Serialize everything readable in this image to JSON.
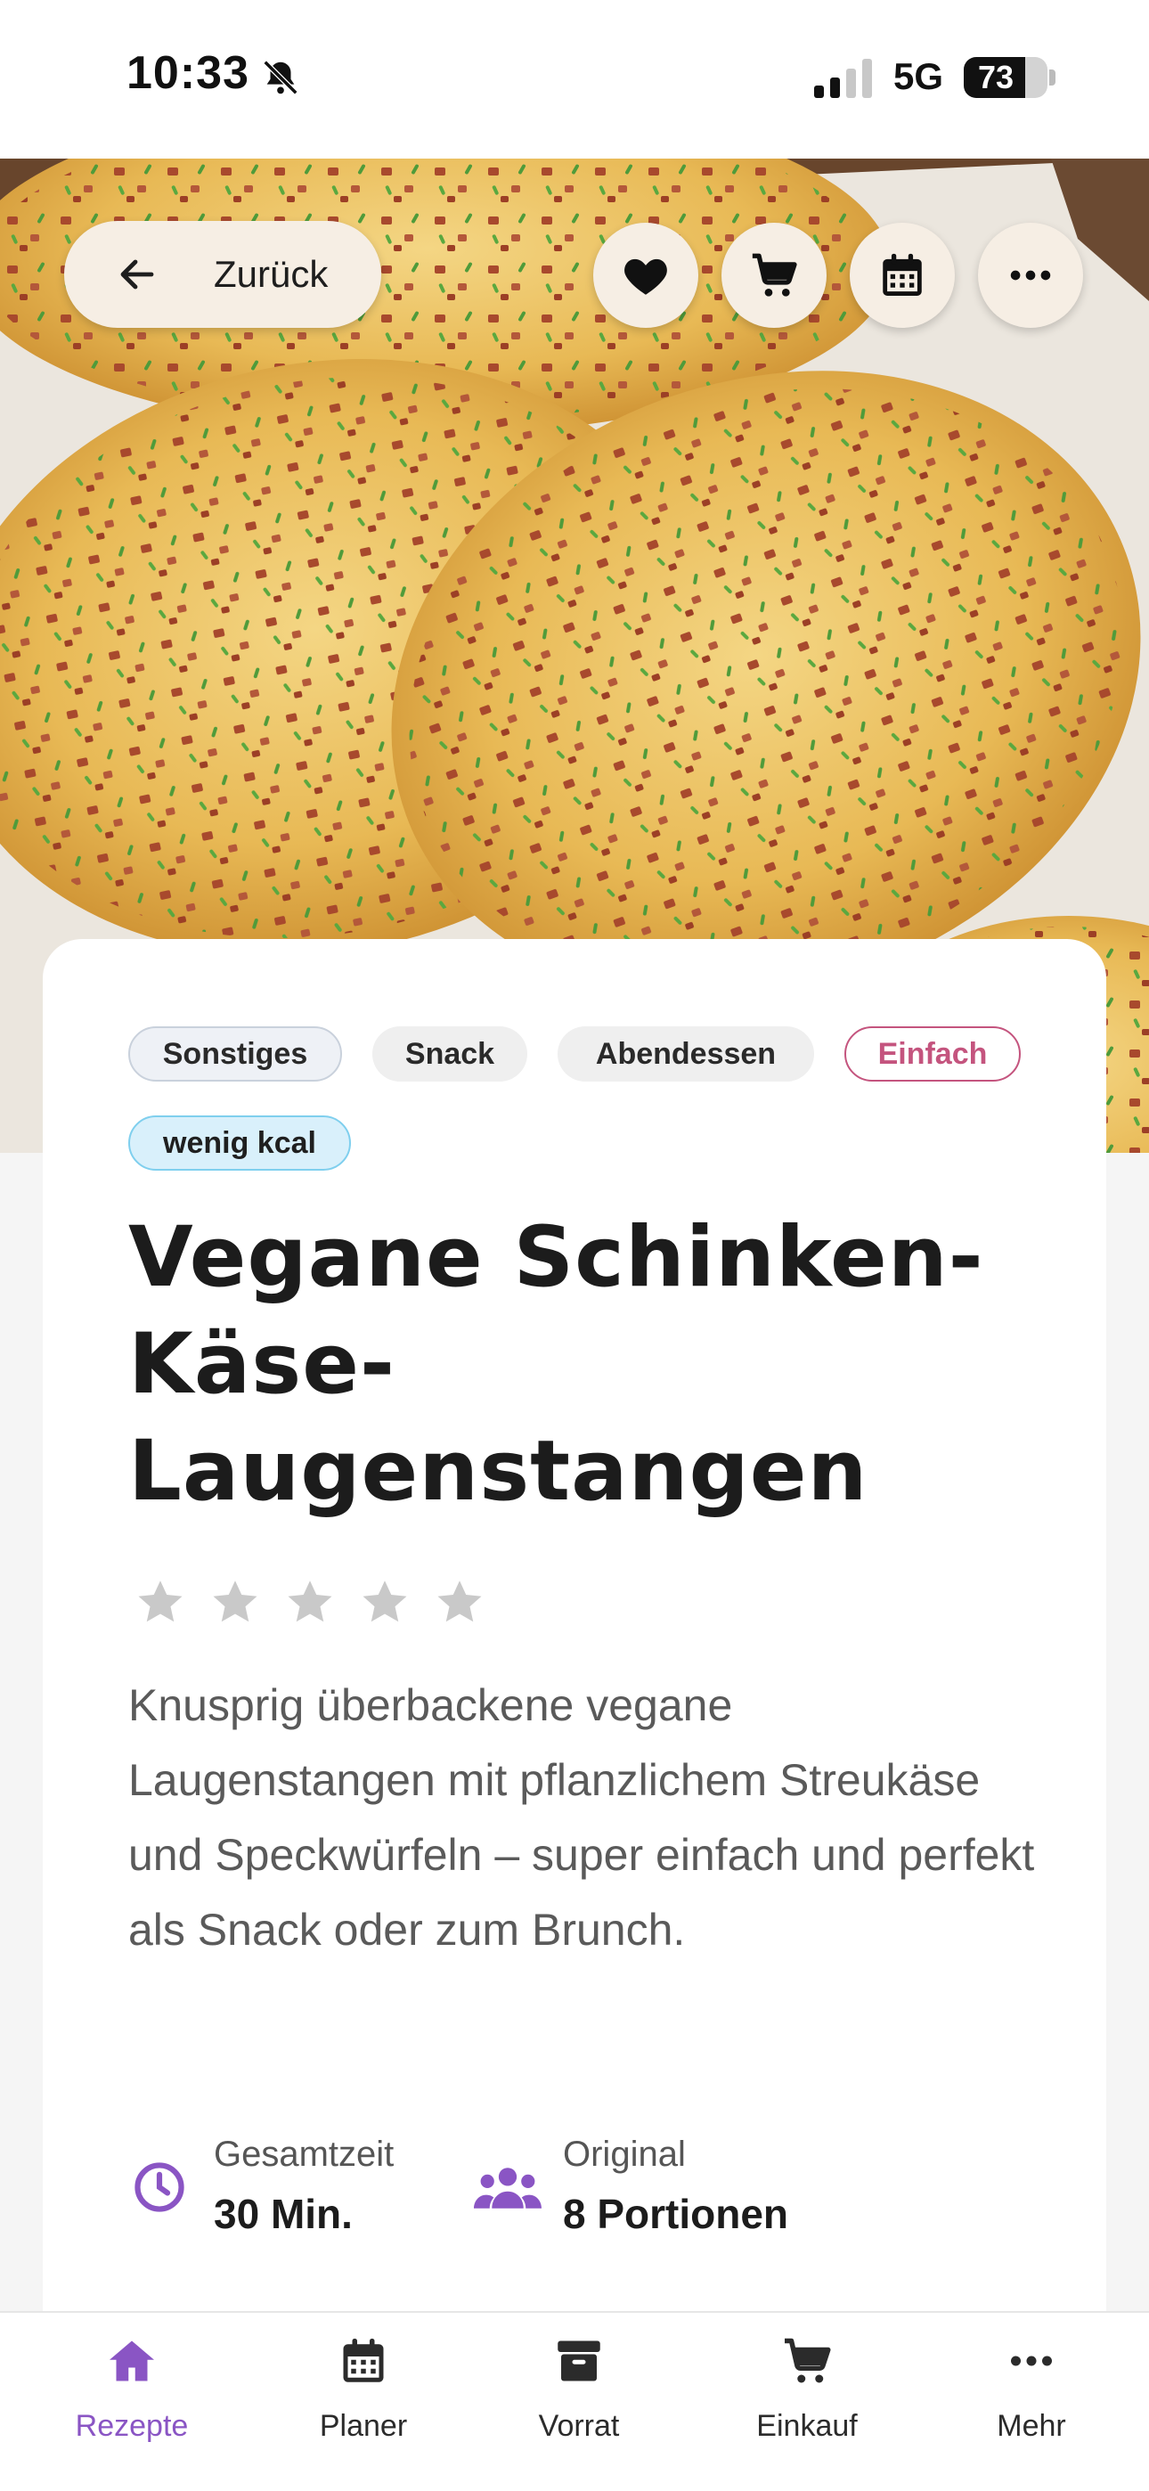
{
  "status_bar": {
    "time": "10:33",
    "network": "5G",
    "battery_percent": "73",
    "battery_level": 0.73,
    "icons": [
      "bell-slash-icon",
      "signal-icon",
      "battery-icon"
    ]
  },
  "header": {
    "back_label": "Zurück",
    "actions": [
      "heart-icon",
      "cart-icon",
      "calendar-icon",
      "more-icon"
    ]
  },
  "recipe": {
    "tags": [
      "Sonstiges",
      "Snack",
      "Abendessen",
      "Einfach",
      "wenig kcal"
    ],
    "title": "Vegane Schinken-Käse-Laugenstangen",
    "title_lines": [
      "Vegane Schinken-",
      "Käse-",
      "Laugenstangen"
    ],
    "rating": 0,
    "rating_max": 5,
    "description": "Knusprig überbackene vegane Laugenstangen mit pflanzlichem Streukäse und Speckwürfeln – super einfach und perfekt als Snack oder zum Brunch.",
    "meta": {
      "time_label": "Gesamtzeit",
      "time_value": "30 Min.",
      "servings_label": "Original",
      "servings_value": "8 Portionen"
    }
  },
  "colors": {
    "accent": "#8a55c4",
    "tag_pink": "#c4547e",
    "tag_blue": "#7fcfee"
  },
  "bottom_nav": {
    "items": [
      {
        "label": "Rezepte",
        "icon": "home-icon",
        "active": true
      },
      {
        "label": "Planer",
        "icon": "calendar-icon",
        "active": false
      },
      {
        "label": "Vorrat",
        "icon": "archive-icon",
        "active": false
      },
      {
        "label": "Einkauf",
        "icon": "cart-icon",
        "active": false
      },
      {
        "label": "Mehr",
        "icon": "more-icon",
        "active": false
      }
    ]
  }
}
